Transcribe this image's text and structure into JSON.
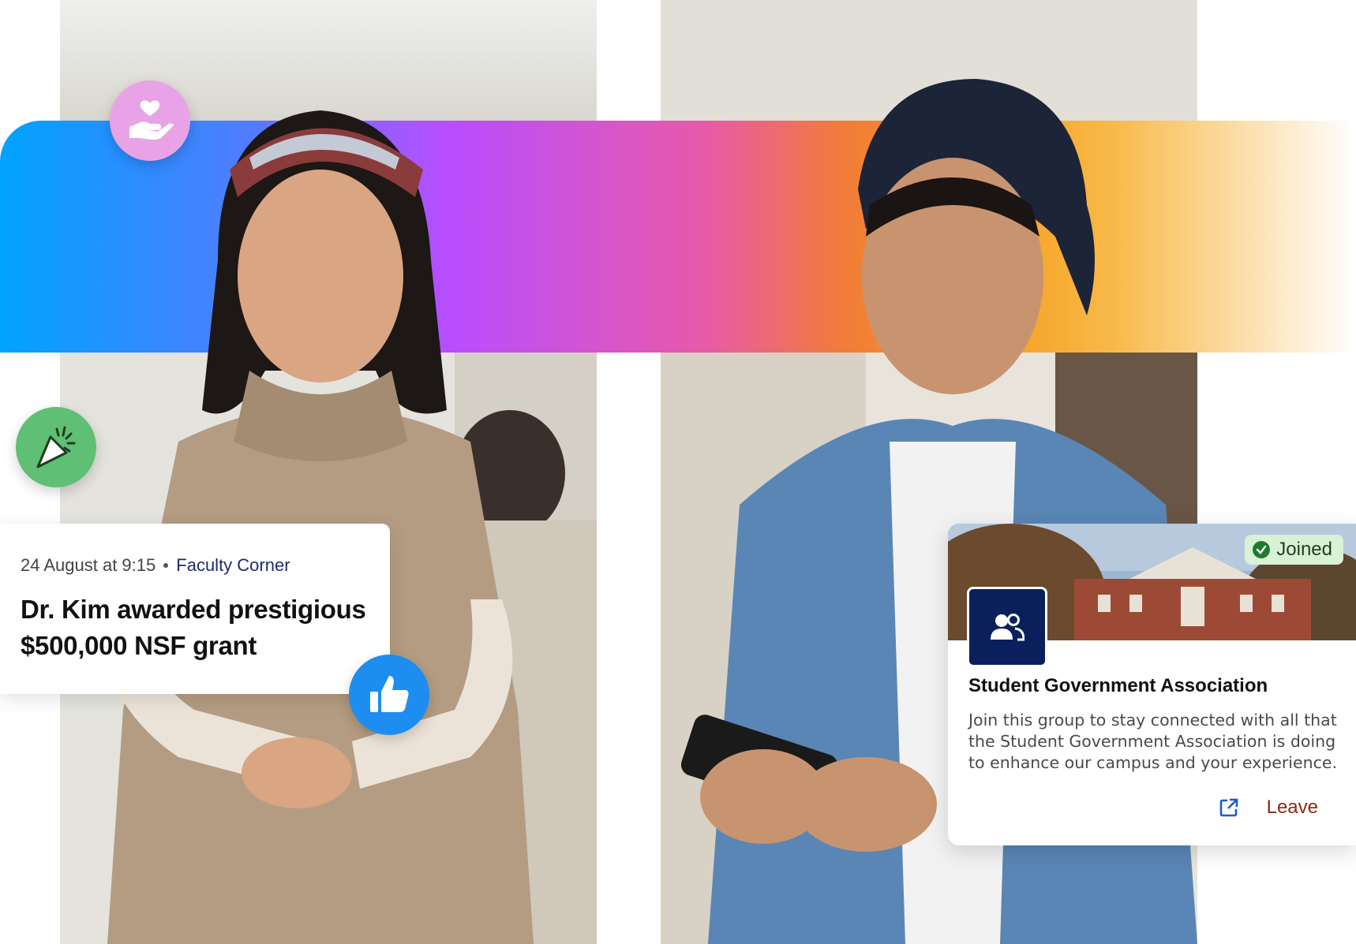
{
  "colors": {
    "band_start": "#00a3ff",
    "band_mid": "#b84dff",
    "band_end": "#f59a1c",
    "badge_care": "#e8a3e6",
    "badge_celebrate": "#5fbf74",
    "badge_like": "#1d8ef0",
    "group_avatar": "#0b1f5c",
    "leave_text": "#8a2a0f",
    "joined_bg": "#d9f2d6"
  },
  "badges": {
    "care_icon": "hand-heart-icon",
    "celebrate_icon": "party-popper-icon",
    "like_icon": "thumbs-up-icon"
  },
  "post": {
    "date": "24 August at 9:15",
    "channel": "Faculty Corner",
    "title": "Dr. Kim awarded prestigious $500,000 NSF grant"
  },
  "group": {
    "status": "Joined",
    "name": "Student Government Association",
    "description": "Join this group to stay connected with all that the Student Government Association is doing to enhance our campus and your experience.",
    "leave_label": "Leave",
    "avatar_icon": "group-users-icon",
    "open_icon": "external-link-icon"
  }
}
